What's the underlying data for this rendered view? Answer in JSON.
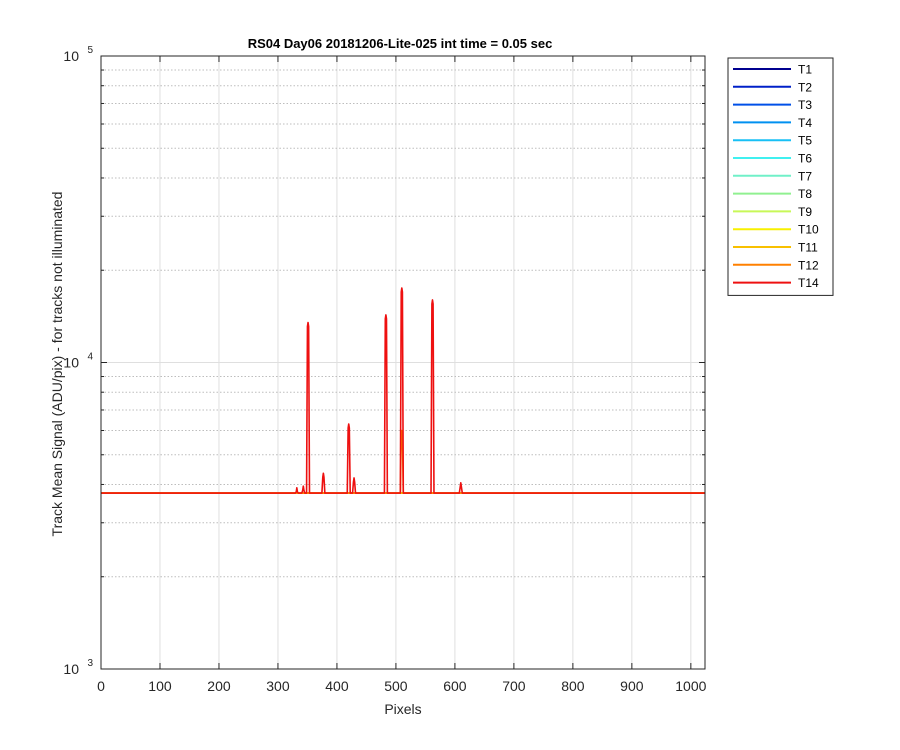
{
  "chart_data": {
    "type": "line",
    "title": "RS04 Day06 20181206-Lite-025 int time = 0.05 sec",
    "xlabel": "Pixels",
    "ylabel": "Track Mean Signal (ADU/pix) - for tracks not illuminated",
    "xlim": [
      0,
      1024
    ],
    "ylim": [
      1000,
      100000
    ],
    "yscale": "log",
    "grid": true,
    "legend_position": "outside-top-right",
    "xticks": [
      0,
      100,
      200,
      300,
      400,
      500,
      600,
      700,
      800,
      900,
      1000
    ],
    "xtick_labels": [
      "0",
      "100",
      "200",
      "300",
      "400",
      "500",
      "600",
      "700",
      "800",
      "900",
      "1000"
    ],
    "yticks": [
      1000,
      10000,
      100000
    ],
    "ytick_labels": [
      {
        "base": "10",
        "exp": "3"
      },
      {
        "base": "10",
        "exp": "4"
      },
      {
        "base": "10",
        "exp": "5"
      }
    ],
    "baseline": 3750,
    "series": [
      {
        "name": "T1",
        "color": "#00008f",
        "peaks": []
      },
      {
        "name": "T2",
        "color": "#0020c8",
        "peaks": []
      },
      {
        "name": "T3",
        "color": "#0050e8",
        "peaks": []
      },
      {
        "name": "T4",
        "color": "#0090f0",
        "peaks": []
      },
      {
        "name": "T5",
        "color": "#18c0f5",
        "peaks": []
      },
      {
        "name": "T6",
        "color": "#40f0f0",
        "peaks": []
      },
      {
        "name": "T7",
        "color": "#70f0c8",
        "peaks": []
      },
      {
        "name": "T8",
        "color": "#90f090",
        "peaks": []
      },
      {
        "name": "T9",
        "color": "#c8f858",
        "peaks": []
      },
      {
        "name": "T10",
        "color": "#f8f000",
        "peaks": []
      },
      {
        "name": "T11",
        "color": "#f8c000",
        "peaks": []
      },
      {
        "name": "T12",
        "color": "#ff8000",
        "peaks": [
          [
            510,
            6000
          ]
        ]
      },
      {
        "name": "T14",
        "color": "#ee1010",
        "peaks": [
          [
            332,
            3900
          ],
          [
            343,
            3950
          ],
          [
            351,
            13500
          ],
          [
            377,
            4350
          ],
          [
            420,
            6300
          ],
          [
            429,
            4200
          ],
          [
            483,
            14300
          ],
          [
            510,
            17500
          ],
          [
            562,
            16000
          ],
          [
            610,
            4050
          ]
        ]
      }
    ]
  }
}
